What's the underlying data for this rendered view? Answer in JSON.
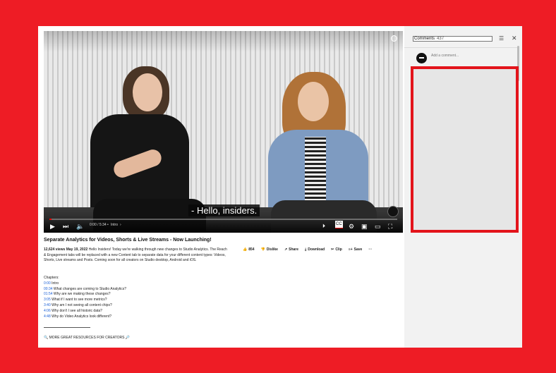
{
  "video": {
    "subtitle": "- Hello, insiders.",
    "time": "0:00 / 5:34",
    "chapter": "Intro",
    "progress_fraction": 0.006
  },
  "meta": {
    "title": "Separate Analytics for Videos, Shorts & Live Streams - Now Launching!",
    "stats": "12,624 views  May 19, 2022",
    "description": "Hello Insiders! Today we're walking through new changes to Studio Analytics. The Reach & Engagement tabs will be replaced with a new Content tab to separate data for your different content types: Videos, Shorts, Live streams and Posts.  Coming soon for all creators on Studio desktop, Android and iOS.",
    "chapters_label": "Chapters:",
    "chapters": [
      {
        "ts": "0:00",
        "text": "Intro"
      },
      {
        "ts": "00:34",
        "text": "What changes are coming to Studio Analytics?"
      },
      {
        "ts": "01:54",
        "text": "Why are we making these changes?"
      },
      {
        "ts": "3:05",
        "text": "What if I want to see more metrics?"
      },
      {
        "ts": "3:40",
        "text": "Why am I not seeing all content chips?"
      },
      {
        "ts": "4:06",
        "text": "Why don't I see all historic data?"
      },
      {
        "ts": "4:48",
        "text": "Why do Video Analytics look different?"
      }
    ],
    "divider": "________________________",
    "resources": "🔍 MORE GREAT RESOURCES FOR CREATORS 🔎"
  },
  "actions": {
    "like": "854",
    "dislike": "Dislike",
    "share": "Share",
    "download": "Download",
    "clip": "Clip",
    "save": "Save",
    "more": "···"
  },
  "comments": {
    "label": "Comments",
    "count": "437",
    "placeholder": "Add a comment..."
  },
  "colors": {
    "background": "#ee1c25",
    "highlight": "#e3141b",
    "progress": "#ff0000",
    "link": "#1a5fd6"
  }
}
